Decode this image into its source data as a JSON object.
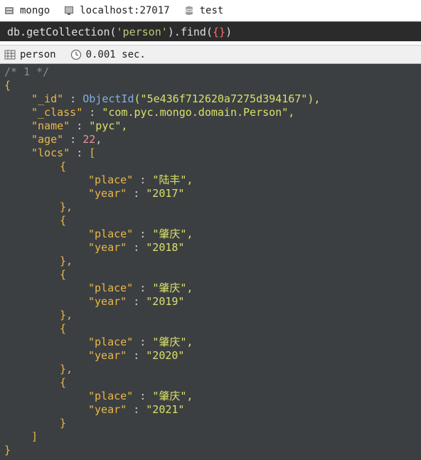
{
  "breadcrumb": {
    "connection": "mongo",
    "server": "localhost:27017",
    "database": "test"
  },
  "query": {
    "prefix": "db.getCollection(",
    "collection_arg": "'person'",
    "mid": ").find(",
    "braces": "{}",
    "suffix": ")"
  },
  "result_bar": {
    "collection": "person",
    "time": "0.001 sec."
  },
  "document": {
    "comment": "/* 1 */",
    "open_brace": "{",
    "close_brace": "}",
    "id_key": "\"_id\"",
    "id_func": "ObjectId",
    "id_value": "(\"5e436f712620a7275d394167\"),",
    "class_key": "\"_class\"",
    "class_value": "\"com.pyc.mongo.domain.Person\",",
    "name_key": "\"name\"",
    "name_value": "\"pyc\",",
    "age_key": "\"age\"",
    "age_value": "22",
    "locs_key": "\"locs\"",
    "locs_open": "[",
    "locs_close": "]",
    "sep": " : ",
    "comma": ",",
    "locs": [
      {
        "place_key": "\"place\"",
        "place_value": "\"陆丰\",",
        "year_key": "\"year\"",
        "year_value": "\"2017\"",
        "open": "{",
        "close": "},"
      },
      {
        "place_key": "\"place\"",
        "place_value": "\"肇庆\",",
        "year_key": "\"year\"",
        "year_value": "\"2018\"",
        "open": "{",
        "close": "},"
      },
      {
        "place_key": "\"place\"",
        "place_value": "\"肇庆\",",
        "year_key": "\"year\"",
        "year_value": "\"2019\"",
        "open": "{",
        "close": "},"
      },
      {
        "place_key": "\"place\"",
        "place_value": "\"肇庆\",",
        "year_key": "\"year\"",
        "year_value": "\"2020\"",
        "open": "{",
        "close": "},"
      },
      {
        "place_key": "\"place\"",
        "place_value": "\"肇庆\",",
        "year_key": "\"year\"",
        "year_value": "\"2021\"",
        "open": "{",
        "close": "}"
      }
    ]
  }
}
